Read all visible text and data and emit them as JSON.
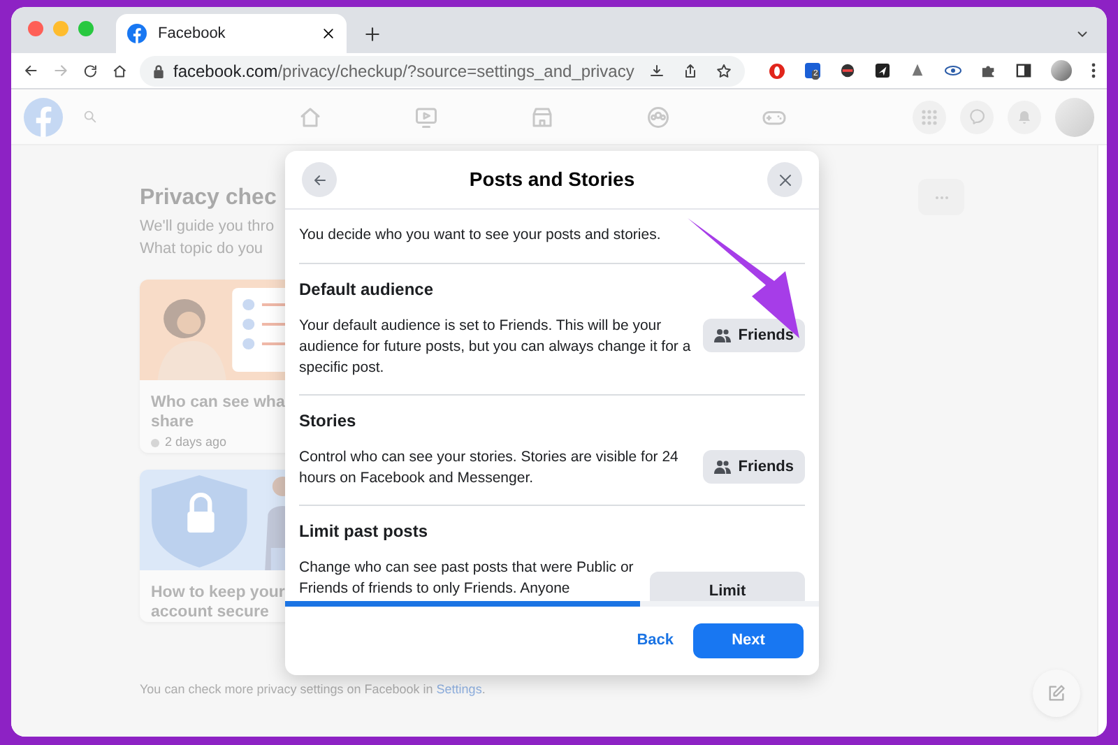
{
  "browser": {
    "tabs": [
      {
        "title": "Facebook",
        "selected": true
      }
    ],
    "url": {
      "domain": "facebook.com",
      "path": "/privacy/checkup/?source=settings_and_privacy"
    },
    "extension_badge": "2"
  },
  "page": {
    "title": "Privacy chec",
    "subtitle_lines": [
      "We'll guide you thro",
      "What topic do you"
    ],
    "cards": [
      {
        "kind": "people",
        "title_lines": [
          "Who can see wha",
          "share"
        ],
        "meta": "2 days ago"
      },
      {
        "kind": "security",
        "title_lines": [
          "How to keep your",
          "account secure"
        ]
      }
    ],
    "footer": {
      "text": "You can check more privacy settings on Facebook in ",
      "link": "Settings",
      "end": "."
    }
  },
  "dialog": {
    "title": "Posts and Stories",
    "intro": "You decide who you want to see your posts and stories.",
    "sections": [
      {
        "kind": "audience",
        "heading": "Default audience",
        "description": "Your default audience is set to Friends. This will be your audience for future posts, but you can always change it for a specific post.",
        "button": "Friends"
      },
      {
        "kind": "audience",
        "heading": "Stories",
        "description": "Control who can see your stories. Stories are visible for 24 hours on Facebook and Messenger.",
        "button": "Friends"
      },
      {
        "kind": "plain",
        "heading": "Limit past posts",
        "description": "Change who can see past posts that were Public or Friends of friends to only Friends. Anyone",
        "button": "Limit"
      }
    ],
    "progress": {
      "level": 0.665
    },
    "back": "Back",
    "next": "Next"
  }
}
